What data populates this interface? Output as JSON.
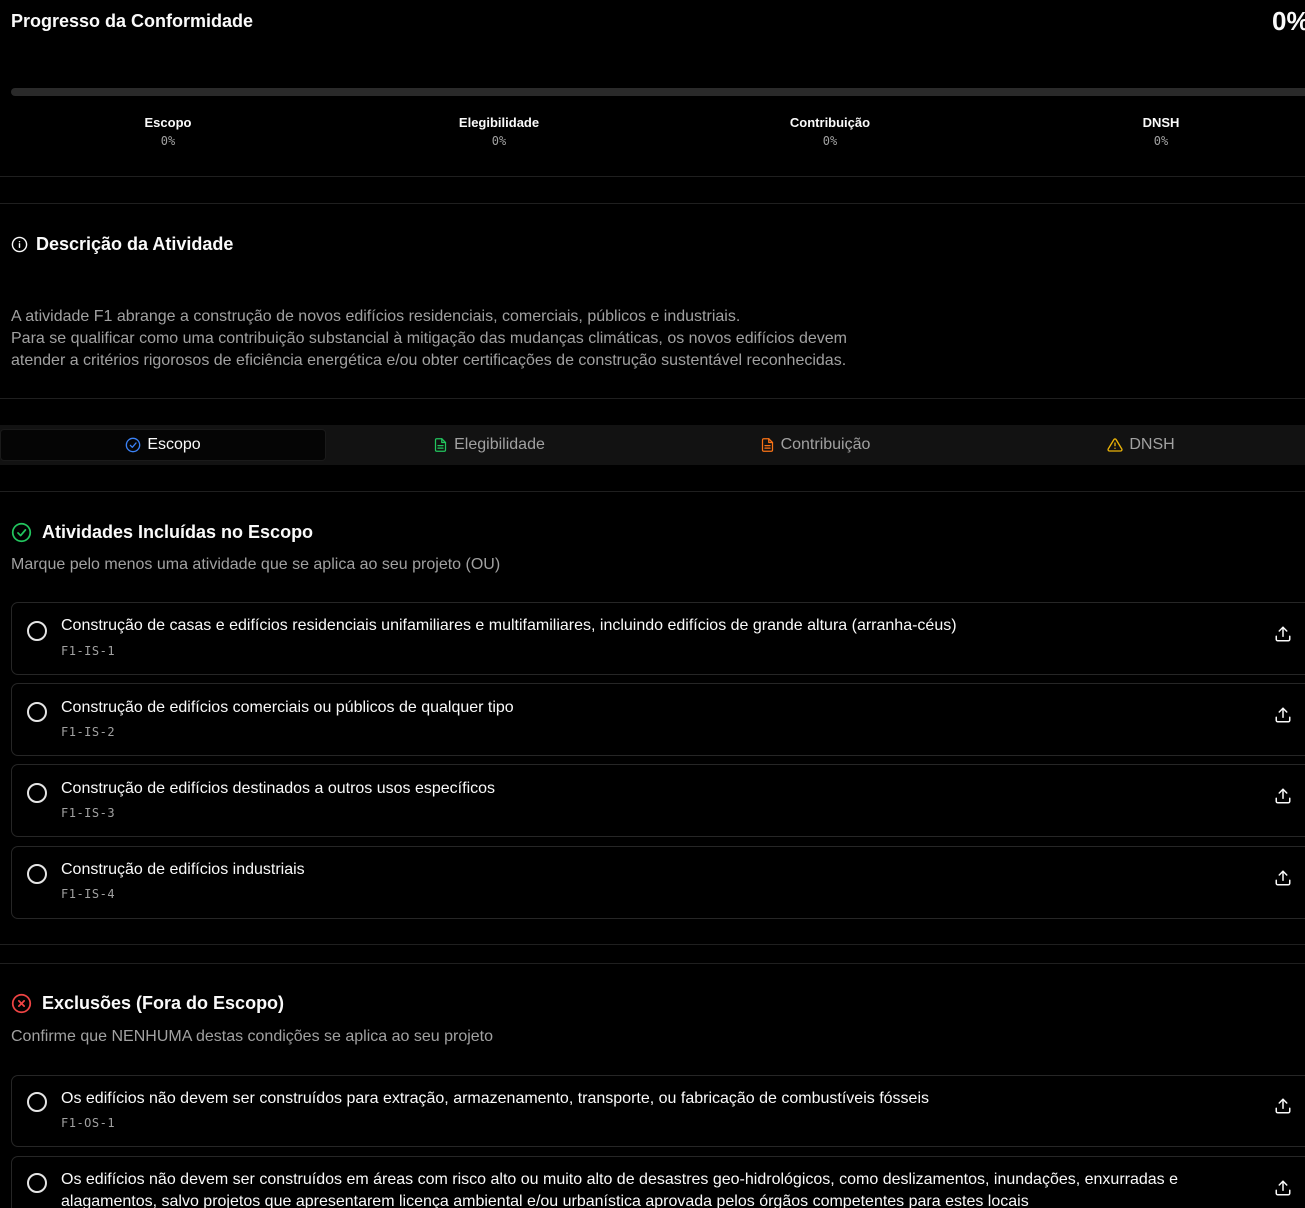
{
  "progress": {
    "title": "Progresso da Conformidade",
    "percent_label": "0%",
    "percent_value": 0,
    "stats": [
      {
        "label": "Escopo",
        "value": "0%"
      },
      {
        "label": "Elegibilidade",
        "value": "0%"
      },
      {
        "label": "Contribuição",
        "value": "0%"
      },
      {
        "label": "DNSH",
        "value": "0%"
      }
    ]
  },
  "description": {
    "title": "Descrição da Atividade",
    "lines": [
      "A atividade F1 abrange a construção de novos edifícios residenciais, comerciais, públicos e industriais.",
      "Para se qualificar como uma contribuição substancial à mitigação das mudanças climáticas, os novos edifícios devem",
      "atender a critérios rigorosos de eficiência energética e/ou obter certificações de construção sustentável reconhecidas."
    ]
  },
  "tabs": [
    {
      "label": "Escopo",
      "icon": "check-circle-icon",
      "color": "#3b82f6",
      "active": true
    },
    {
      "label": "Elegibilidade",
      "icon": "file-text-icon",
      "color": "#22c55e",
      "active": false
    },
    {
      "label": "Contribuição",
      "icon": "file-text-icon",
      "color": "#f97316",
      "active": false
    },
    {
      "label": "DNSH",
      "icon": "warning-triangle-icon",
      "color": "#eab308",
      "active": false
    }
  ],
  "included": {
    "title": "Atividades Incluídas no Escopo",
    "subtitle": "Marque pelo menos uma atividade que se aplica ao seu projeto (OU)",
    "icon_color": "#22c55e",
    "items": [
      {
        "text": "Construção de casas e edifícios residenciais unifamiliares e multifamiliares, incluindo edifícios de grande altura (arranha-céus)",
        "code": "F1-IS-1"
      },
      {
        "text": "Construção de edifícios comerciais ou públicos de qualquer tipo",
        "code": "F1-IS-2"
      },
      {
        "text": "Construção de edifícios destinados a outros usos específicos",
        "code": "F1-IS-3"
      },
      {
        "text": "Construção de edifícios industriais",
        "code": "F1-IS-4"
      }
    ]
  },
  "exclusions": {
    "title": "Exclusões (Fora do Escopo)",
    "subtitle": "Confirme que NENHUMA destas condições se aplica ao seu projeto",
    "icon_color": "#ef4444",
    "items": [
      {
        "text": "Os edifícios não devem ser construídos para extração, armazenamento, transporte, ou fabricação de combustíveis fósseis",
        "code": "F1-OS-1"
      },
      {
        "text": "Os edifícios não devem ser construídos em áreas com risco alto ou muito alto de desastres geo-hidrológicos, como deslizamentos, inundações, enxurradas e alagamentos, salvo projetos que apresentarem licença ambiental e/ou urbanística aprovada pelos órgãos competentes para estes locais",
        "code": ""
      }
    ]
  }
}
